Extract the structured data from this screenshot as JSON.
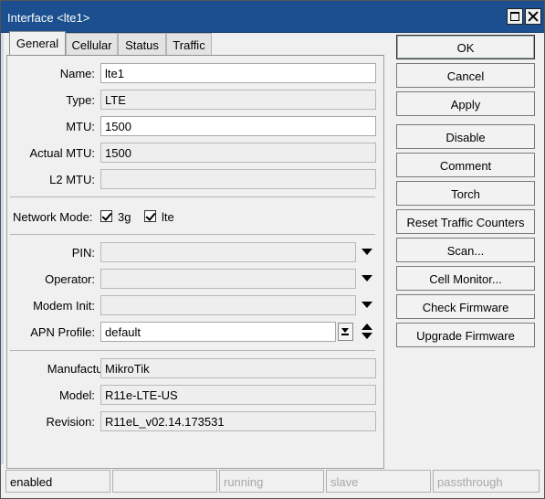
{
  "window": {
    "title": "Interface <lte1>"
  },
  "tabs": [
    "General",
    "Cellular",
    "Status",
    "Traffic"
  ],
  "general": {
    "name_label": "Name:",
    "name_value": "lte1",
    "type_label": "Type:",
    "type_value": "LTE",
    "mtu_label": "MTU:",
    "mtu_value": "1500",
    "actual_mtu_label": "Actual MTU:",
    "actual_mtu_value": "1500",
    "l2mtu_label": "L2 MTU:",
    "l2mtu_value": "",
    "network_mode_label": "Network Mode:",
    "network_modes": [
      {
        "label": "3g",
        "checked": true
      },
      {
        "label": "lte",
        "checked": true
      }
    ],
    "pin_label": "PIN:",
    "pin_value": "",
    "operator_label": "Operator:",
    "operator_value": "",
    "modem_init_label": "Modem Init:",
    "modem_init_value": "",
    "apn_profile_label": "APN Profile:",
    "apn_profile_value": "default",
    "manufacturer_label": "Manufacturer:",
    "manufacturer_value": "MikroTik",
    "model_label": "Model:",
    "model_value": "R11e-LTE-US",
    "revision_label": "Revision:",
    "revision_value": "R11eL_v02.14.173531"
  },
  "buttons": [
    "OK",
    "Cancel",
    "Apply",
    "Disable",
    "Comment",
    "Torch",
    "Reset Traffic Counters",
    "Scan...",
    "Cell Monitor...",
    "Check Firmware",
    "Upgrade Firmware"
  ],
  "statusbar": [
    "enabled",
    "",
    "running",
    "slave",
    "passthrough"
  ],
  "colors": {
    "titlebar": "#1b4f8f",
    "window_bg": "#f0f0f0"
  }
}
